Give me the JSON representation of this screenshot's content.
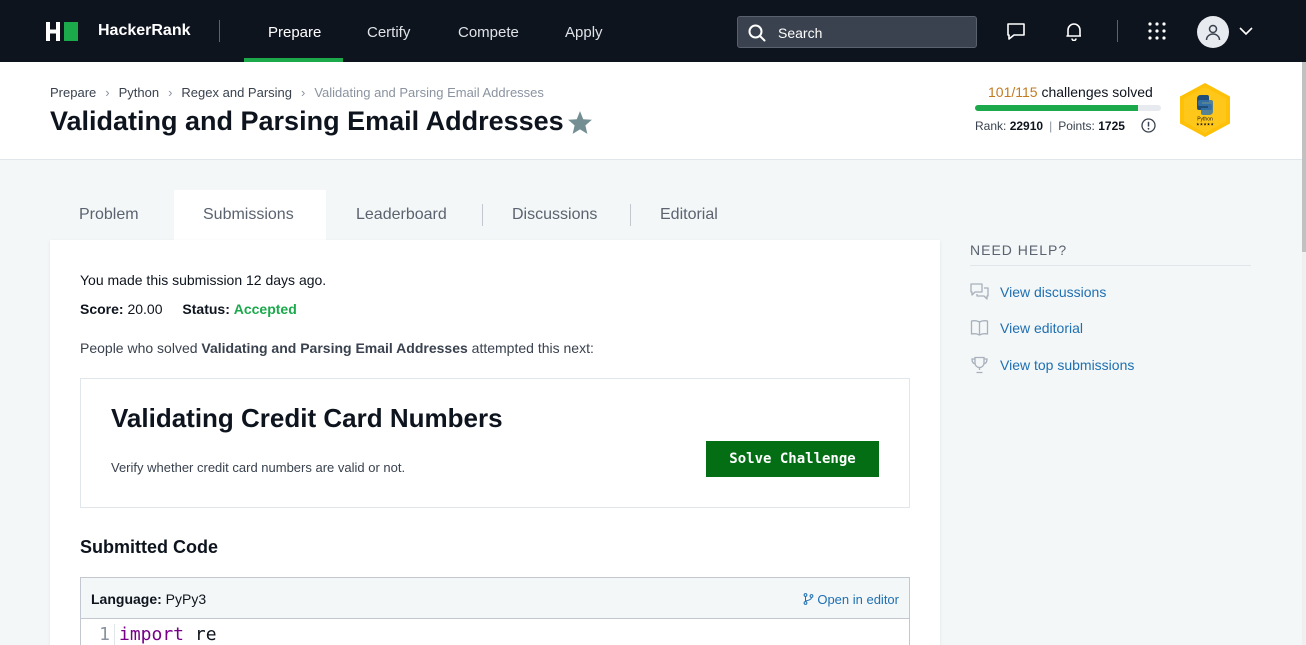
{
  "nav": {
    "brand": "HackerRank",
    "links": [
      "Prepare",
      "Certify",
      "Compete",
      "Apply"
    ],
    "active": "Prepare",
    "search_placeholder": "Search",
    "icons": [
      "hackerrank-logo-icon",
      "search-icon",
      "chat-icon",
      "bell-icon",
      "apps-grid-icon",
      "avatar-icon",
      "chevron-down-icon"
    ]
  },
  "header": {
    "breadcrumbs": [
      "Prepare",
      "Python",
      "Regex and Parsing",
      "Validating and Parsing Email Addresses"
    ],
    "title": "Validating and Parsing Email Addresses",
    "progress": {
      "solved": "101/115",
      "solved_label": "challenges solved",
      "fraction": 0.878
    },
    "rank_label": "Rank:",
    "rank_value": "22910",
    "points_label": "Points:",
    "points_value": "1725",
    "badge_text": "Python",
    "badge_stars": "★★★★★",
    "badge_color": "#ffc107"
  },
  "tabs": [
    "Problem",
    "Submissions",
    "Leaderboard",
    "Discussions",
    "Editorial"
  ],
  "active_tab": "Submissions",
  "submission": {
    "made_text": "You made this submission 12 days ago.",
    "score_label": "Score:",
    "score_value": "20.00",
    "status_label": "Status:",
    "status_value": "Accepted",
    "people_prefix": "People who solved",
    "people_challenge": "Validating and Parsing Email Addresses",
    "people_suffix": "attempted this next:"
  },
  "next_challenge": {
    "title": "Validating Credit Card Numbers",
    "description": "Verify whether credit card numbers are valid or not.",
    "button": "Solve Challenge"
  },
  "code": {
    "heading": "Submitted Code",
    "language_label": "Language:",
    "language_value": "PyPy3",
    "open_editor": "Open in editor",
    "line_number": "1",
    "keyword": "import",
    "module": "re"
  },
  "help": {
    "title": "NEED HELP?",
    "items": [
      "View discussions",
      "View editorial",
      "View top submissions"
    ]
  },
  "colors": {
    "accent_green": "#1ba94c",
    "button_green": "#046e15",
    "link_blue": "#1f6fb2",
    "nav_bg": "#0e141e"
  }
}
